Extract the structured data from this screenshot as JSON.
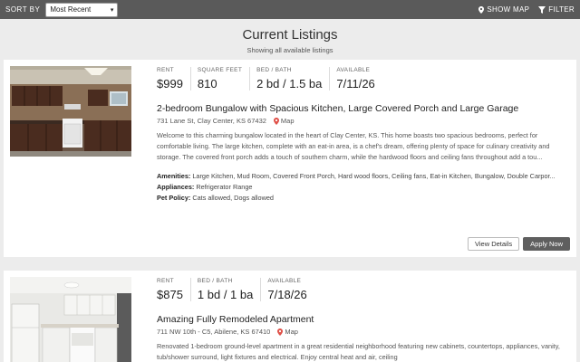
{
  "toolbar": {
    "sort_label": "SORT BY",
    "sort_value": "Most Recent",
    "show_map": "SHOW MAP",
    "filter": "FILTER"
  },
  "page": {
    "title": "Current Listings",
    "subtitle": "Showing all available listings"
  },
  "listings": [
    {
      "stats": [
        {
          "label": "RENT",
          "value": "$999"
        },
        {
          "label": "SQUARE FEET",
          "value": "810"
        },
        {
          "label": "BED / BATH",
          "value": "2 bd / 1.5 ba"
        },
        {
          "label": "AVAILABLE",
          "value": "7/11/26"
        }
      ],
      "title": "2-bedroom Bungalow with Spacious Kitchen, Large Covered Porch and Large Garage",
      "address": "731 Lane St, Clay Center, KS 67432",
      "map_label": "Map",
      "description": "Welcome to this charming bungalow located in the heart of Clay Center, KS. This home boasts two spacious bedrooms, perfect for comfortable living. The large kitchen, complete with an eat-in area, is a chef's dream, offering plenty of space for culinary creativity and storage. The covered front porch adds a touch of southern charm, while the hardwood floors and ceiling fans throughout add a tou...",
      "amenities_label": "Amenities:",
      "amenities": "Large Kitchen, Mud Room, Covered Front Porch, Hard wood floors, Ceiling fans, Eat-in Kitchen, Bungalow, Double Carpor...",
      "appliances_label": "Appliances:",
      "appliances": "Refrigerator Range",
      "pet_label": "Pet Policy:",
      "pet": "Cats allowed, Dogs allowed",
      "view_details": "View Details",
      "apply_now": "Apply Now"
    },
    {
      "stats": [
        {
          "label": "RENT",
          "value": "$875"
        },
        {
          "label": "BED / BATH",
          "value": "1 bd / 1 ba"
        },
        {
          "label": "AVAILABLE",
          "value": "7/18/26"
        }
      ],
      "title": "Amazing Fully Remodeled Apartment",
      "address": "711 NW 10th - C5, Abilene, KS 67410",
      "map_label": "Map",
      "description": "Renovated 1-bedroom ground-level apartment in a great residential neighborhood featuring new cabinets, countertops, appliances, vanity, tub/shower surround, light fixtures and electrical. Enjoy central heat and air, ceiling"
    }
  ],
  "colors": {
    "topbar": "#5a5a5a",
    "background": "#ececec",
    "map_pin": "#e0524a",
    "apply_button": "#5f5f5f"
  }
}
